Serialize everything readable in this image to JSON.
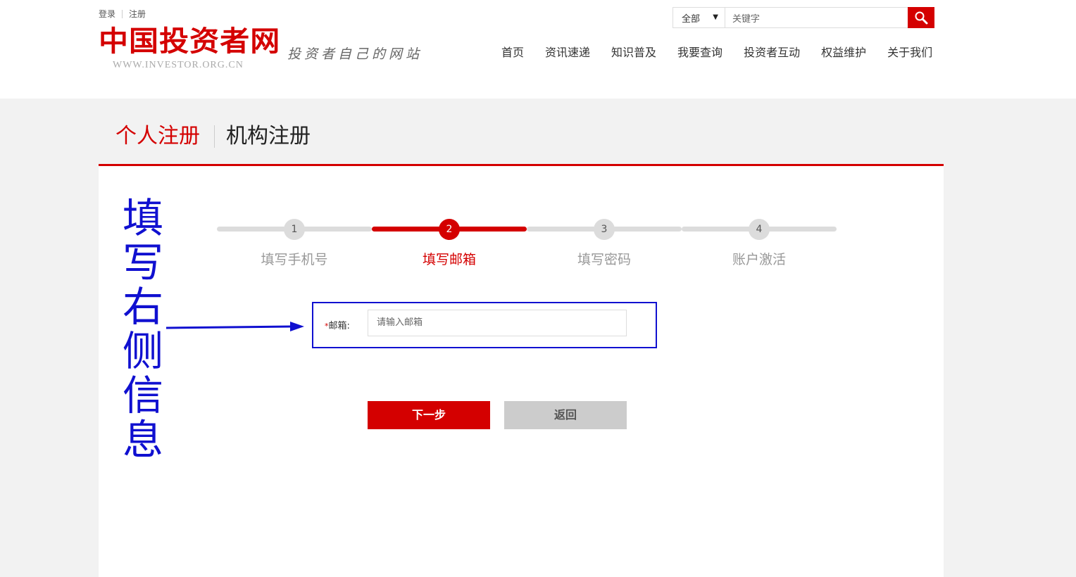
{
  "header": {
    "top_links": {
      "login": "登录",
      "register": "注册"
    },
    "logo": {
      "main": "中国投资者网",
      "url": "WWW.INVESTOR.ORG.CN",
      "slogan": "投资者自己的网站"
    },
    "search": {
      "category": "全部",
      "placeholder": "关键字"
    },
    "nav": [
      "首页",
      "资讯速递",
      "知识普及",
      "我要查询",
      "投资者互动",
      "权益维护",
      "关于我们"
    ]
  },
  "tabs": {
    "active": "个人注册",
    "other": "机构注册"
  },
  "steps": [
    {
      "number": "1",
      "label": "填写手机号"
    },
    {
      "number": "2",
      "label": "填写邮箱"
    },
    {
      "number": "3",
      "label": "填写密码"
    },
    {
      "number": "4",
      "label": "账户激活"
    }
  ],
  "current_step": 2,
  "form": {
    "required_mark": "*",
    "email_label": "邮箱:",
    "email_placeholder": "请输入邮箱",
    "email_value": ""
  },
  "buttons": {
    "next": "下一步",
    "back": "返回"
  },
  "annotation": {
    "chars": [
      "填",
      "写",
      "右",
      "侧",
      "信",
      "息"
    ]
  },
  "colors": {
    "brand_red": "#d40000",
    "annotation_blue": "#1010d0",
    "inactive_gray": "#dcdcdc"
  },
  "icons": {
    "search_button": "search-icon",
    "select_caret": "caret-down-icon",
    "annotation_arrow": "arrow-right-icon"
  }
}
